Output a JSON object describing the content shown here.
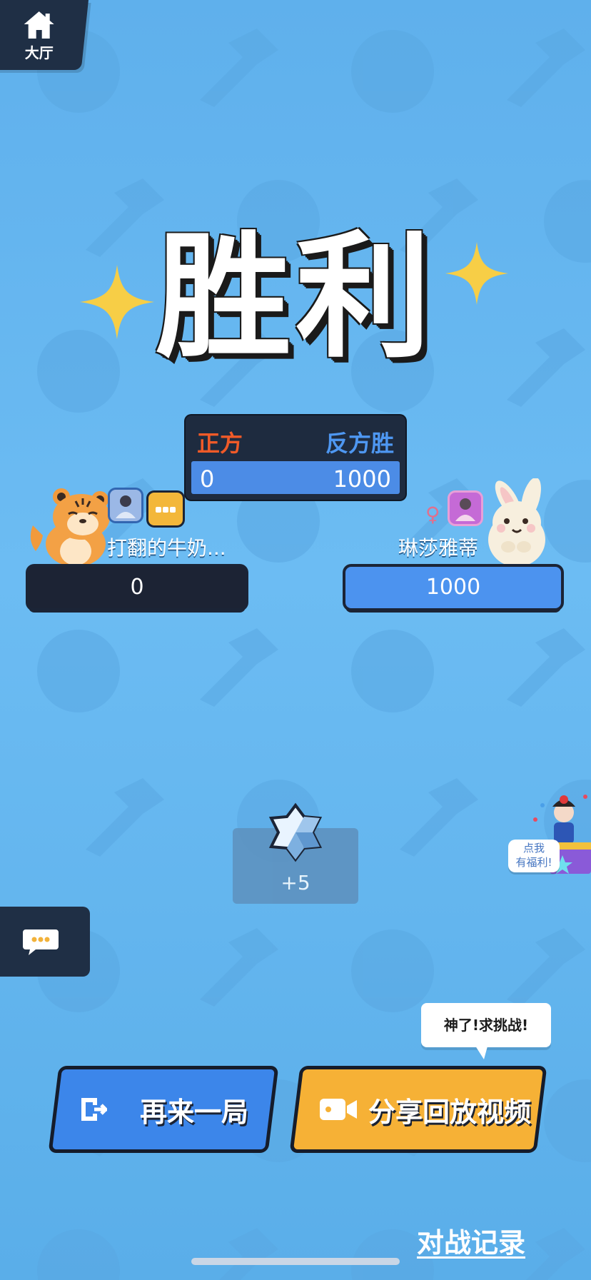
{
  "home": {
    "label": "大厅"
  },
  "result": {
    "title": "胜利"
  },
  "scoreboard": {
    "left_team": "正方",
    "right_team": "反方胜",
    "left_score": "0",
    "right_score": "1000"
  },
  "players": {
    "left": {
      "name": "打翻的牛奶...",
      "score": "0",
      "animal": "tiger-icon"
    },
    "right": {
      "name": "琳莎雅蒂",
      "score": "1000",
      "animal": "rabbit-icon",
      "gender": "♀"
    }
  },
  "reward": {
    "value": "+5",
    "icon": "crystal-icon"
  },
  "welfare": {
    "line1": "点我",
    "line2": "有福利!"
  },
  "share_bubble": {
    "text": "神了!求挑战!"
  },
  "buttons": {
    "play_again": "再来一局",
    "share_replay": "分享回放视频"
  },
  "records_link": "对战记录",
  "colors": {
    "background": "#66b6f0",
    "panel_dark": "#1e2b3f",
    "accent_blue": "#3c86ea",
    "accent_orange": "#f6b136",
    "left_team": "#f05a28",
    "right_team": "#4e97f1"
  }
}
